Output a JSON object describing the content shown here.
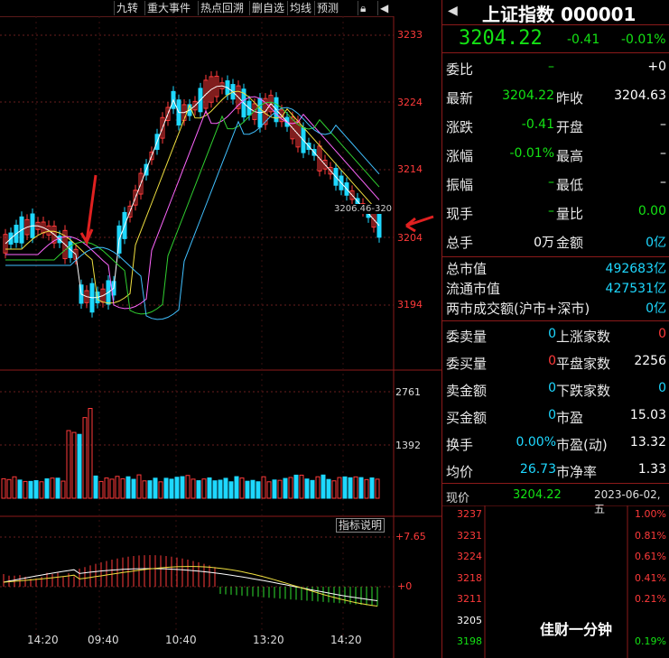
{
  "toolbar": {
    "items": [
      "九转",
      "重大事件",
      "热点回溯",
      "删自选",
      "均线",
      "预测"
    ],
    "lock_icon": "lock-icon",
    "pin_icon": "pin-icon"
  },
  "price_axis": [
    "3233",
    "3224",
    "3214",
    "3204",
    "3194"
  ],
  "volume_axis": [
    "2761",
    "1392"
  ],
  "indicator_axis": [
    "+7.65",
    "+0"
  ],
  "indicator_button": "指标说明",
  "cursor_readout": "3206.46-320",
  "time_axis": [
    "14:20",
    "09:40",
    "10:40",
    "13:20",
    "14:20"
  ],
  "panel": {
    "title": "上证指数 000001",
    "price": "3204.22",
    "change": "-0.41",
    "change_pct": "-0.01%",
    "rows1": [
      {
        "l1": "委比",
        "v1": "–",
        "l2": "",
        "v2": "+0"
      },
      {
        "l1": "最新",
        "v1": "3204.22",
        "l2": "昨收",
        "v2": "3204.63"
      },
      {
        "l1": "涨跌",
        "v1": "-0.41",
        "l2": "开盘",
        "v2": "–"
      },
      {
        "l1": "涨幅",
        "v1": "-0.01%",
        "l2": "最高",
        "v2": "–"
      },
      {
        "l1": "振幅",
        "v1": "–",
        "l2": "最低",
        "v2": "–"
      },
      {
        "l1": "现手",
        "v1": "–",
        "l2": "量比",
        "v2": "0.00"
      },
      {
        "l1": "总手",
        "v1": "0万",
        "l2": "金额",
        "v2": "0亿"
      }
    ],
    "cap": [
      {
        "l": "总市值",
        "v": "492683亿"
      },
      {
        "l": "流通市值",
        "v": "427531亿"
      },
      {
        "l": "两市成交额(沪市+深市)",
        "v": "0亿"
      }
    ],
    "rows2": [
      {
        "l1": "委卖量",
        "v1": "0",
        "l2": "上涨家数",
        "v2": "0"
      },
      {
        "l1": "委买量",
        "v1": "0",
        "l2": "平盘家数",
        "v2": "2256"
      },
      {
        "l1": "卖金额",
        "v1": "0",
        "l2": "下跌家数",
        "v2": "0"
      },
      {
        "l1": "买金额",
        "v1": "0",
        "l2": "市盈",
        "v2": "15.03"
      },
      {
        "l1": "换手",
        "v1": "0.00%",
        "l2": "市盈(动)",
        "v2": "13.32"
      },
      {
        "l1": "均价",
        "v1": "26.73",
        "l2": "市净率",
        "v2": "1.33"
      }
    ],
    "now_label": "现价",
    "now_price": "3204.22",
    "date": "2023-06-02,五",
    "mini_left": [
      "3237",
      "3231",
      "3224",
      "3218",
      "3211",
      "3205",
      "3198"
    ],
    "mini_right": [
      "1.00%",
      "0.81%",
      "0.61%",
      "0.41%",
      "0.21%",
      "",
      "0.19%"
    ],
    "watermark": "佳财一分钟"
  },
  "colors": {
    "up": "#ff3a3a",
    "down": "#1ed8ff",
    "bg": "#000000",
    "grid": "#5a1a1a"
  }
}
